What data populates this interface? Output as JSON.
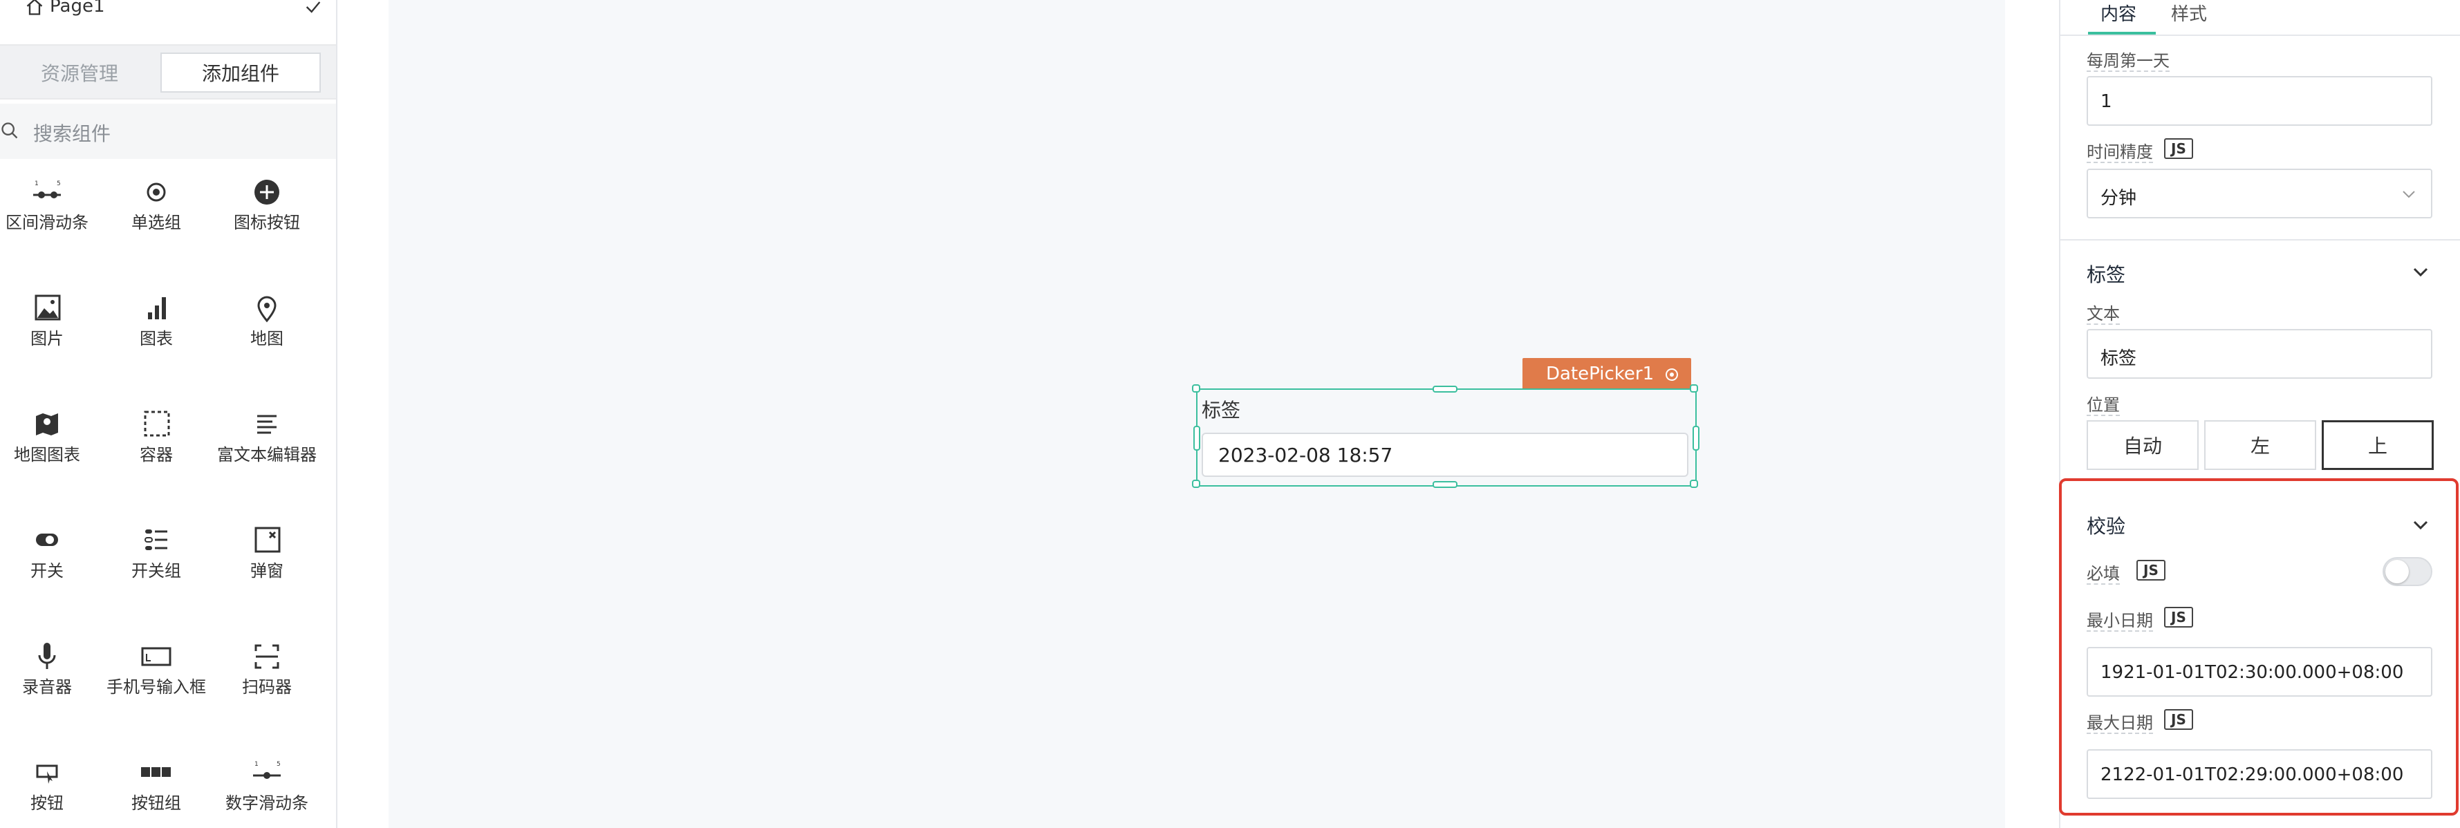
{
  "sidebar": {
    "page_name": "Page1",
    "tab_assets": "资源管理",
    "tab_add": "添加组件",
    "search_placeholder": "搜索组件",
    "components": [
      {
        "label": "区间滑动条",
        "icon": "range-slider-icon"
      },
      {
        "label": "单选组",
        "icon": "radio-icon"
      },
      {
        "label": "图标按钮",
        "icon": "plus-circle-icon"
      },
      {
        "label": "图片",
        "icon": "image-icon"
      },
      {
        "label": "图表",
        "icon": "bar-chart-icon"
      },
      {
        "label": "地图",
        "icon": "map-pin-icon"
      },
      {
        "label": "地图图表",
        "icon": "map-chart-icon"
      },
      {
        "label": "容器",
        "icon": "container-icon"
      },
      {
        "label": "富文本编辑器",
        "icon": "rich-text-icon"
      },
      {
        "label": "开关",
        "icon": "switch-icon"
      },
      {
        "label": "开关组",
        "icon": "switch-group-icon"
      },
      {
        "label": "弹窗",
        "icon": "modal-icon"
      },
      {
        "label": "录音器",
        "icon": "microphone-icon"
      },
      {
        "label": "手机号输入框",
        "icon": "phone-input-icon"
      },
      {
        "label": "扫码器",
        "icon": "scan-icon"
      },
      {
        "label": "按钮",
        "icon": "button-icon"
      },
      {
        "label": "按钮组",
        "icon": "button-group-icon"
      },
      {
        "label": "数字滑动条",
        "icon": "number-slider-icon"
      }
    ]
  },
  "canvas": {
    "component_tag": "DatePicker1",
    "widget_label": "标签",
    "widget_value": "2023-02-08 18:57"
  },
  "panel": {
    "tab_content": "内容",
    "tab_style": "样式",
    "first_day_label": "每周第一天",
    "first_day_value": "1",
    "precision_label": "时间精度",
    "precision_value": "分钟",
    "js_badge": "JS",
    "label_section": "标签",
    "text_label": "文本",
    "text_value": "标签",
    "position_label": "位置",
    "pos_auto": "自动",
    "pos_left": "左",
    "pos_top": "上",
    "validation_section": "校验",
    "required_label": "必填",
    "min_date_label": "最小日期",
    "min_date_value": "1921-01-01T02:30:00.000+08:00",
    "max_date_label": "最大日期",
    "max_date_value": "2122-01-01T02:29:00.000+08:00"
  },
  "colors": {
    "accent": "#3bbf9e",
    "tag": "#e07b4a",
    "highlight": "#e03b2f"
  }
}
